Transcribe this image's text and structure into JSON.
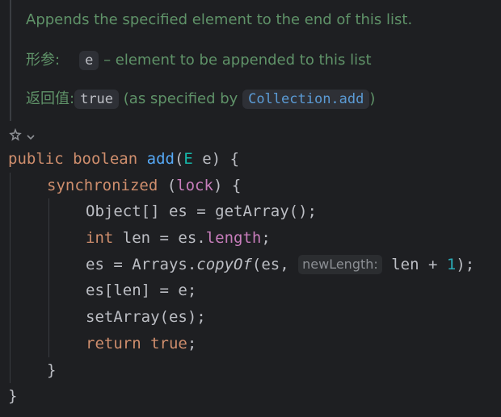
{
  "javadoc": {
    "description": "Appends the specified element to the end of this list.",
    "params_label": "形参:",
    "param_name": "e",
    "param_desc": "– element to be appended to this list",
    "returns_label": "返回值:",
    "returns_value": "true",
    "returns_prefix": "(as specified by",
    "returns_link": "Collection.add",
    "returns_suffix": ")"
  },
  "toolbar": {
    "icon_name": "ai-assistant-icon",
    "dropdown_icon": "chevron-down-icon"
  },
  "code": {
    "l1": {
      "kw_public": "public",
      "kw_boolean": "boolean",
      "method": "add",
      "open_paren": "(",
      "param_type": "E",
      "param_rest": " e) {"
    },
    "l2": {
      "kw_sync": "synchronized",
      "open": " (",
      "lock_field": "lock",
      "close": ") {"
    },
    "l3": {
      "text_a": "Object[] es = ",
      "call": "getArray",
      "text_b": "();"
    },
    "l4": {
      "kw_int": "int",
      "text_a": " len = es.",
      "field": "length",
      "text_b": ";"
    },
    "l5": {
      "text_a": "es = Arrays.",
      "method": "copyOf",
      "text_b": "(es, ",
      "hint": "newLength:",
      "text_c": "len + ",
      "number": "1",
      "text_d": ");"
    },
    "l6": {
      "text": "es[len] = e;"
    },
    "l7": {
      "text": "setArray(es);"
    },
    "l8": {
      "kw_return": "return",
      "kw_true": "true",
      "semi": ";"
    },
    "l9": {
      "text": "}"
    },
    "l10": {
      "text": "}"
    }
  }
}
